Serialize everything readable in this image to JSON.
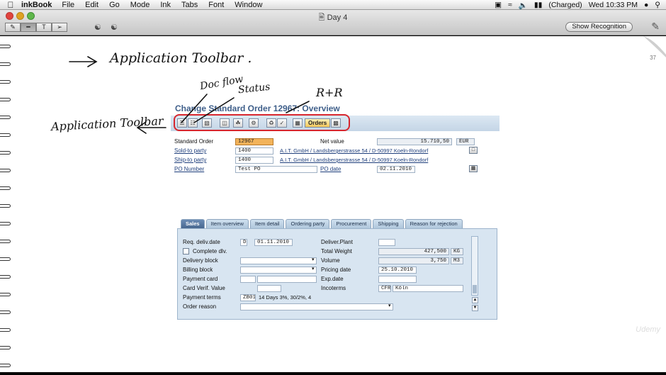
{
  "menubar": {
    "app_name": "inkBook",
    "menus": [
      "File",
      "Edit",
      "Go",
      "Mode",
      "Ink",
      "Tabs",
      "Font",
      "Window"
    ],
    "battery": "(Charged)",
    "clock": "Wed 10:33 PM"
  },
  "window": {
    "title": "Day 4",
    "show_recognition": "Show Recognition",
    "page_number": "37"
  },
  "handwriting": {
    "heading": "Application Toolbar .",
    "side_label": "Application Toolbar",
    "doc_flow": "Doc flow",
    "status": "Status",
    "rr": "R+R"
  },
  "sap": {
    "title": "Change Standard Order 12967: Overview",
    "toolbar_orders": "Orders",
    "header": {
      "standard_order_label": "Standard Order",
      "standard_order_value": "12967",
      "net_value_label": "Net value",
      "net_value": "15.710,50",
      "currency": "EUR",
      "sold_to_label": "Sold-to party",
      "sold_to_value": "1400",
      "sold_to_text": "A.I.T. GmbH / Landsbergerstrasse 54 / D-50997 Koeln-Rondorf",
      "ship_to_label": "Ship-to party",
      "ship_to_value": "1400",
      "ship_to_text": "A.I.T. GmbH / Landsbergerstrasse 54 / D-50997 Koeln-Rondorf",
      "po_number_label": "PO Number",
      "po_number_value": "Test PO",
      "po_date_label": "PO date",
      "po_date_value": "02.11.2010"
    },
    "tabs": [
      "Sales",
      "Item overview",
      "Item detail",
      "Ordering party",
      "Procurement",
      "Shipping",
      "Reason for rejection"
    ],
    "sales": {
      "req_deliv_date_label": "Req. deliv.date",
      "req_deliv_date_format": "D",
      "req_deliv_date_value": "01.11.2010",
      "complete_dlv_label": "Complete dlv.",
      "delivery_block_label": "Delivery block",
      "billing_block_label": "Billing block",
      "payment_card_label": "Payment card",
      "card_verif_label": "Card Verif. Value",
      "payment_terms_label": "Payment terms",
      "payment_terms_value": "ZB01",
      "payment_terms_text": "14 Days 3%, 30/2%, 4",
      "order_reason_label": "Order reason",
      "deliver_plant_label": "Deliver.Plant",
      "total_weight_label": "Total Weight",
      "total_weight_value": "427,500",
      "weight_unit": "KG",
      "volume_label": "Volume",
      "volume_value": "3,750",
      "volume_unit": "M3",
      "pricing_date_label": "Pricing date",
      "pricing_date_value": "25.10.2010",
      "exp_date_label": "Exp.date",
      "incoterms_label": "Incoterms",
      "incoterms_code": "CFR",
      "incoterms_place": "Köln"
    }
  },
  "colors": {
    "sap_title": "#3f5f8a",
    "highlight_ring": "#d7262e",
    "order_field": "#f2b35a"
  }
}
